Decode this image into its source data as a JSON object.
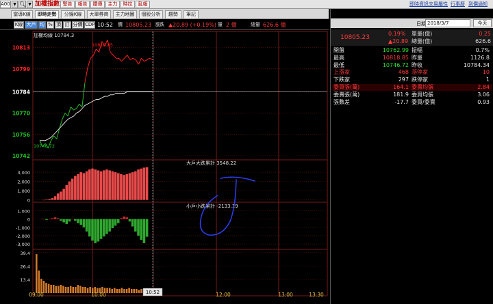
{
  "topbar": {
    "symbol_value": "A00",
    "app_title": "加權指數",
    "buttons": [
      "警告",
      "報告",
      "體傳",
      "主力",
      "時拉",
      "亂報"
    ],
    "links": [
      "即時資訊",
      "交易屬性",
      "行事曆",
      "到價通知"
    ]
  },
  "tabs": [
    {
      "label": "當導K線",
      "active": false
    },
    {
      "label": "即時走勢",
      "active": true
    },
    {
      "label": "分鐘K線",
      "active": false
    },
    {
      "label": "大單券商",
      "active": false
    },
    {
      "label": "主力地圖",
      "active": false
    },
    {
      "label": "個股分析",
      "active": false
    },
    {
      "label": "趨勢",
      "active": false
    },
    {
      "label": "筆記",
      "active": false
    }
  ],
  "toolbar": {
    "buttons": [
      {
        "label": "K線",
        "active": false
      },
      {
        "label": "大戶",
        "active": true
      },
      {
        "label": "均",
        "active": true
      },
      {
        "label": "%",
        "active": false
      },
      {
        "label": "頂",
        "active": false
      },
      {
        "label": "訂",
        "active": false
      },
      {
        "label": "分價",
        "active": false
      },
      {
        "label": "CDP",
        "active": false
      }
    ],
    "time": "10:52",
    "price_label": "價",
    "price_value": "10805.23",
    "change_label": "漲跌",
    "change_value": "▲20.89 (+0.19%)",
    "volume_label": "量",
    "volume_value": "2 億",
    "total_label": "總量",
    "total_value": "626.6 億"
  },
  "colors": {
    "up": "#ff2020",
    "down": "#22c022",
    "avg_line": "#d8d8d8",
    "grid": "#7a1a1a",
    "accent_blue": "#4a86d8"
  },
  "chart_data": [
    {
      "type": "line",
      "title": "加權均線 10784.3",
      "y_ticks": [
        "10813",
        "10799",
        "10784",
        "10770",
        "10756",
        "10742"
      ],
      "ylim": [
        10742,
        10820
      ],
      "reference": 10784.34,
      "high_label": "10818.85",
      "low_label": "10746.72",
      "x_ticks": [
        "09:00",
        "10:00",
        "10:52",
        "12:00",
        "13:00",
        "13:30"
      ],
      "price": [
        10752,
        10748,
        10750,
        10747,
        10752,
        10755,
        10753,
        10760,
        10766,
        10770,
        10768,
        10774,
        10772,
        10773,
        10776,
        10774,
        10790,
        10800,
        10806,
        10808,
        10812,
        10810,
        10817,
        10814,
        10818,
        10810,
        10808,
        10806,
        10806,
        10804,
        10806,
        10808,
        10805,
        10806,
        10805,
        10802,
        10806,
        10804,
        10805,
        10806,
        10805
      ],
      "avg": [
        10752,
        10752,
        10752,
        10753,
        10754,
        10756,
        10758,
        10760,
        10762,
        10764,
        10766,
        10767,
        10768,
        10770,
        10771,
        10773,
        10775,
        10776,
        10777,
        10778,
        10779,
        10779,
        10780,
        10781,
        10781,
        10782,
        10782,
        10783,
        10783,
        10783,
        10783,
        10784,
        10784,
        10784,
        10784,
        10784,
        10784,
        10784,
        10784,
        10784,
        10784
      ]
    },
    {
      "type": "area",
      "title": "大戶大跌累計 3548.22",
      "y_ticks": [
        "3,000",
        "2,000",
        "1,000",
        "0"
      ],
      "ylim": [
        -100,
        3600
      ],
      "values": [
        0,
        50,
        100,
        200,
        400,
        700,
        900,
        1200,
        1600,
        2000,
        2300,
        2600,
        2800,
        3000,
        2900,
        3100,
        3300,
        3400,
        3300,
        3200,
        3100,
        3200,
        3300,
        3200,
        3100,
        3000,
        2900,
        2800,
        2700,
        2800,
        2900,
        3000,
        3100,
        3300,
        3400,
        3500,
        3548
      ]
    },
    {
      "type": "area",
      "title": "小戶小跌累計 -2133.19",
      "y_ticks": [
        "1,000",
        "0",
        "-1,000",
        "-2,000",
        "-3,000"
      ],
      "ylim": [
        -3400,
        1200
      ],
      "values": [
        0,
        -100,
        0,
        100,
        200,
        100,
        -200,
        -400,
        -600,
        -300,
        0,
        -200,
        -500,
        -700,
        -1000,
        -1500,
        -2100,
        -2600,
        -2900,
        -2700,
        -2400,
        -2100,
        -1800,
        -1500,
        -1100,
        -800,
        -500,
        100,
        300,
        200,
        -300,
        -900,
        -1500,
        -2000,
        -2500,
        -2900,
        -2133
      ]
    },
    {
      "type": "bar",
      "title": "",
      "y_ticks": [
        "39.4",
        "26.4",
        "13.4"
      ],
      "ylim": [
        0,
        40
      ],
      "values": [
        38,
        22,
        14,
        12,
        10,
        9,
        8,
        8,
        7,
        7,
        8,
        7,
        6,
        6,
        7,
        6,
        6,
        8,
        7,
        6,
        6,
        5,
        6,
        5,
        6,
        5,
        5,
        6,
        5,
        5,
        5,
        4,
        5,
        4,
        4,
        5,
        4,
        4,
        5,
        4,
        4,
        4,
        3,
        4,
        3,
        4,
        3,
        3
      ]
    }
  ],
  "quote": {
    "date_label": "日期:",
    "date_value": "2018/3/7",
    "today_label": "今天",
    "header": {
      "price": "10805.23",
      "pct": "0.19%",
      "change": "▲20.89",
      "unit_vol_label": "單量(億)",
      "unit_vol_value": "0.25",
      "total_vol_label": "總量(億)",
      "total_vol_value": "626.6"
    },
    "rows": [
      {
        "l1": "開盤",
        "v1": "10762.99",
        "c1": "down",
        "l2": "振幅",
        "v2": "0.7%",
        "c2": "white",
        "hl": false
      },
      {
        "l1": "最高",
        "v1": "10818.85",
        "c1": "up",
        "l2": "昨量",
        "v2": "1126.8",
        "c2": "white",
        "hl": false
      },
      {
        "l1": "最低",
        "v1": "10746.72",
        "c1": "down",
        "l2": "昨收",
        "v2": "10784.34",
        "c2": "white",
        "hl": false
      },
      {
        "l1": "上漲家",
        "v1": "468",
        "c1": "up",
        "l2": "漲停家",
        "v2": "10",
        "c2": "up",
        "hl": false
      },
      {
        "l1": "下跌家",
        "v1": "297",
        "c1": "white",
        "l2": "跌停家",
        "v2": "1",
        "c2": "white",
        "hl": false
      },
      {
        "l1": "委買張(萬)",
        "v1": "164.1",
        "c1": "up",
        "l2": "委賣均張",
        "v2": "2.84",
        "c2": "up",
        "hl": true
      },
      {
        "l1": "委賣張(萬)",
        "v1": "181.9",
        "c1": "white",
        "l2": "委買均張",
        "v2": "3.06",
        "c2": "white",
        "hl": false
      },
      {
        "l1": "張數差",
        "v1": "-17.7",
        "c1": "white",
        "l2": "委買/委賣",
        "v2": "0.93",
        "c2": "white",
        "hl": false
      }
    ]
  }
}
